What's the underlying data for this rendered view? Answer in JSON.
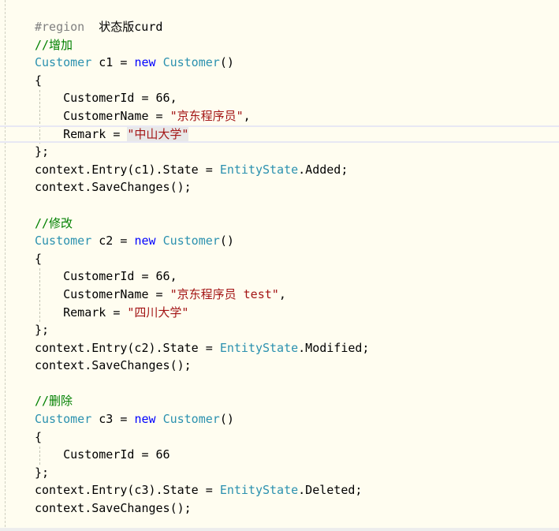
{
  "editor": {
    "current_line": 6,
    "colors": {
      "background": "#fffdf0",
      "plain": "#000000",
      "keyword": "#0000ff",
      "type": "#2b91af",
      "string": "#a31515",
      "comment": "#008000",
      "preproc": "#808080"
    },
    "lines": [
      [
        [
          "preproc",
          "#region"
        ],
        [
          "plain",
          "  状态版curd"
        ]
      ],
      [
        [
          "comment",
          "//增加"
        ]
      ],
      [
        [
          "type",
          "Customer"
        ],
        [
          "plain",
          " c1 = "
        ],
        [
          "keyword",
          "new"
        ],
        [
          "plain",
          " "
        ],
        [
          "type",
          "Customer"
        ],
        [
          "plain",
          "()"
        ]
      ],
      [
        [
          "plain",
          "{"
        ]
      ],
      [
        [
          "plain",
          "    CustomerId = 66,"
        ]
      ],
      [
        [
          "plain",
          "    CustomerName = "
        ],
        [
          "string",
          "\"京东程序员\""
        ],
        [
          "plain",
          ","
        ]
      ],
      [
        [
          "plain",
          "    Remark = "
        ],
        [
          "string",
          "\"中山大学\""
        ]
      ],
      [
        [
          "plain",
          "};"
        ]
      ],
      [
        [
          "plain",
          "context.Entry(c1).State = "
        ],
        [
          "type",
          "EntityState"
        ],
        [
          "plain",
          ".Added;"
        ]
      ],
      [
        [
          "plain",
          "context.SaveChanges();"
        ]
      ],
      [
        [
          "plain",
          ""
        ]
      ],
      [
        [
          "comment",
          "//修改"
        ]
      ],
      [
        [
          "type",
          "Customer"
        ],
        [
          "plain",
          " c2 = "
        ],
        [
          "keyword",
          "new"
        ],
        [
          "plain",
          " "
        ],
        [
          "type",
          "Customer"
        ],
        [
          "plain",
          "()"
        ]
      ],
      [
        [
          "plain",
          "{"
        ]
      ],
      [
        [
          "plain",
          "    CustomerId = 66,"
        ]
      ],
      [
        [
          "plain",
          "    CustomerName = "
        ],
        [
          "string",
          "\"京东程序员 test\""
        ],
        [
          "plain",
          ","
        ]
      ],
      [
        [
          "plain",
          "    Remark = "
        ],
        [
          "string",
          "\"四川大学\""
        ]
      ],
      [
        [
          "plain",
          "};"
        ]
      ],
      [
        [
          "plain",
          "context.Entry(c2).State = "
        ],
        [
          "type",
          "EntityState"
        ],
        [
          "plain",
          ".Modified;"
        ]
      ],
      [
        [
          "plain",
          "context.SaveChanges();"
        ]
      ],
      [
        [
          "plain",
          ""
        ]
      ],
      [
        [
          "comment",
          "//删除"
        ]
      ],
      [
        [
          "type",
          "Customer"
        ],
        [
          "plain",
          " c3 = "
        ],
        [
          "keyword",
          "new"
        ],
        [
          "plain",
          " "
        ],
        [
          "type",
          "Customer"
        ],
        [
          "plain",
          "()"
        ]
      ],
      [
        [
          "plain",
          "{"
        ]
      ],
      [
        [
          "plain",
          "    CustomerId = 66"
        ]
      ],
      [
        [
          "plain",
          "};"
        ]
      ],
      [
        [
          "plain",
          "context.Entry(c3).State = "
        ],
        [
          "type",
          "EntityState"
        ],
        [
          "plain",
          ".Deleted;"
        ]
      ],
      [
        [
          "plain",
          "context.SaveChanges();"
        ]
      ]
    ]
  }
}
